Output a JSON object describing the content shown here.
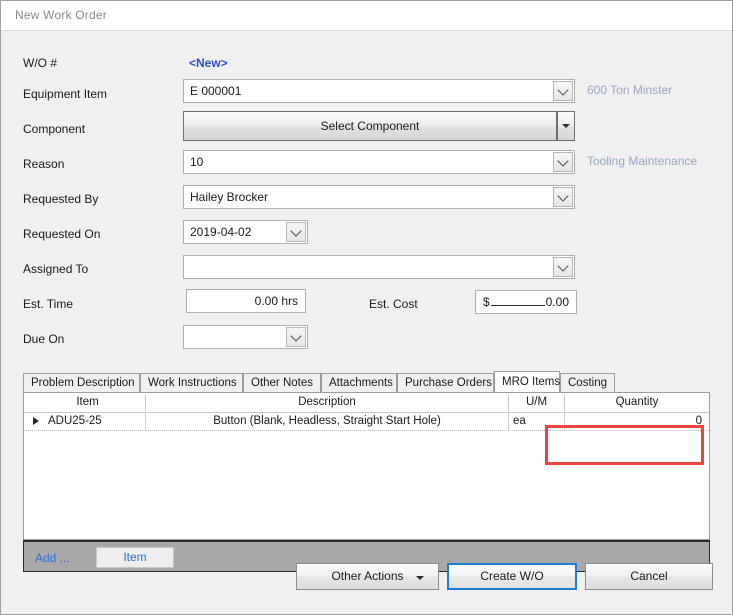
{
  "window": {
    "title": "New Work Order"
  },
  "form": {
    "wo_number": {
      "label": "W/O #",
      "value": "<New>"
    },
    "equipment_item": {
      "label": "Equipment Item",
      "value": "E 000001",
      "side_note": "600 Ton Minster"
    },
    "component": {
      "label": "Component",
      "button_label": "Select Component"
    },
    "reason": {
      "label": "Reason",
      "value": "10",
      "side_note": "Tooling Maintenance"
    },
    "requested_by": {
      "label": "Requested By",
      "value": "Hailey Brocker"
    },
    "requested_on": {
      "label": "Requested On",
      "value": "2019-04-02"
    },
    "assigned_to": {
      "label": "Assigned To",
      "value": ""
    },
    "est_time": {
      "label": "Est. Time",
      "value": "0.00 hrs"
    },
    "est_cost": {
      "label": "Est. Cost",
      "currency_symbol": "$",
      "amount": "0.00"
    },
    "due_on": {
      "label": "Due On",
      "value": ""
    }
  },
  "tabs": [
    {
      "label": "Problem Description",
      "active": false
    },
    {
      "label": "Work Instructions",
      "active": false
    },
    {
      "label": "Other Notes",
      "active": false
    },
    {
      "label": "Attachments",
      "active": false
    },
    {
      "label": "Purchase Orders",
      "active": false
    },
    {
      "label": "MRO Items",
      "active": true
    },
    {
      "label": "Costing",
      "active": false
    }
  ],
  "grid": {
    "columns": [
      "Item",
      "Description",
      "U/M",
      "Quantity"
    ],
    "rows": [
      {
        "item": "ADU25-25",
        "description": "Button (Blank, Headless, Straight Start Hole)",
        "um": "ea",
        "quantity": "0"
      }
    ],
    "toolbar": {
      "add_label": "Add ...",
      "item_label": "Item"
    },
    "highlight_color": "#e8453c"
  },
  "footer": {
    "other_actions": "Other Actions",
    "create_wo": "Create W/O",
    "cancel": "Cancel"
  }
}
